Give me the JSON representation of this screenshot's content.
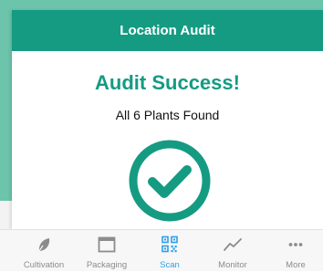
{
  "modal": {
    "title": "Location Audit",
    "success_title": "Audit Success!",
    "success_message": "All 6 Plants Found"
  },
  "colors": {
    "brand_teal": "#159b82",
    "background_teal": "#6cc4ab",
    "active_tab": "#2f9fe6",
    "inactive_tab": "#8c8c8c"
  },
  "tabbar": {
    "active": "Scan",
    "items": [
      {
        "label": "Cultivation",
        "icon": "leaf-icon"
      },
      {
        "label": "Packaging",
        "icon": "window-icon"
      },
      {
        "label": "Scan",
        "icon": "qr-code-icon"
      },
      {
        "label": "Monitor",
        "icon": "line-chart-icon"
      },
      {
        "label": "More",
        "icon": "more-dots-icon"
      }
    ]
  }
}
